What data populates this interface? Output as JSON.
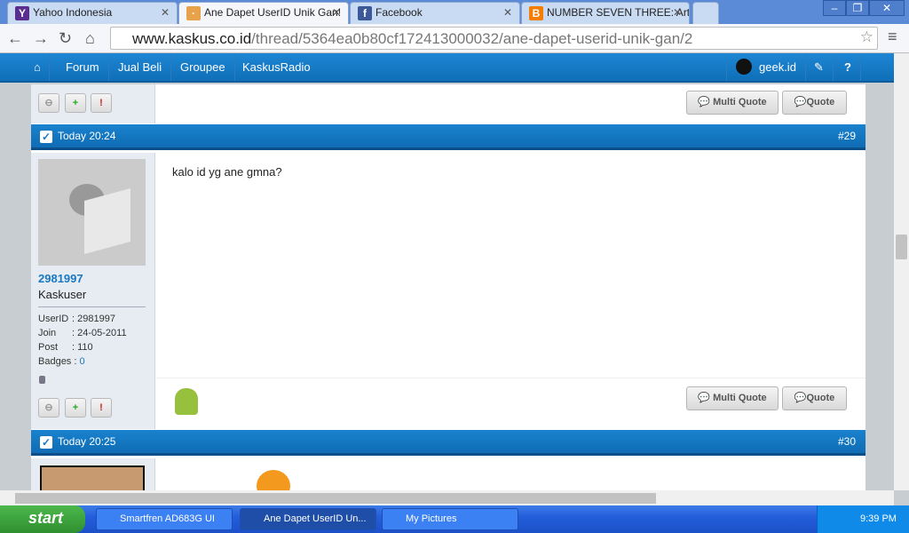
{
  "browser": {
    "tabs": [
      {
        "label": "Yahoo Indonesia",
        "icon": "yahoo-icon",
        "color": "#5c2d91"
      },
      {
        "label": "Ane Dapet UserID Unik Gan!",
        "icon": "kaskus-icon",
        "color": "#e8a24a"
      },
      {
        "label": "Facebook",
        "icon": "facebook-icon",
        "color": "#3b5998"
      },
      {
        "label": "NUMBER SEVEN THREE: Arti",
        "icon": "blogger-icon",
        "color": "#f57d00"
      }
    ],
    "url_host": "www.kaskus.co.id",
    "url_path": "/thread/5364ea0b80cf172413000032/ane-dapet-userid-unik-gan/2"
  },
  "sitenav": {
    "items": [
      "Forum",
      "Jual Beli",
      "Groupee",
      "KaskusRadio"
    ],
    "username": "geek.id"
  },
  "buttons": {
    "multi_quote": "Multi Quote",
    "quote": "Quote"
  },
  "posts": [
    {
      "time": "Today 20:24",
      "number": "#29",
      "username": "2981997",
      "rank": "Kaskuser",
      "info": [
        {
          "label": "UserID",
          "value": ": 2981997"
        },
        {
          "label": "Join",
          "value": ": 24-05-2011"
        },
        {
          "label": "Post",
          "value": ": 110"
        },
        {
          "label": "Badges",
          "value": ": ",
          "link": "0"
        }
      ],
      "body": "kalo id yg ane gmna?"
    },
    {
      "time": "Today 20:25",
      "number": "#30"
    }
  ],
  "taskbar": {
    "start": "start",
    "items": [
      "Smartfren AD683G UI",
      "Ane Dapet UserID Un...",
      "My Pictures"
    ],
    "clock": "9:39 PM"
  },
  "colors": {
    "accent": "#1a7ac5",
    "username": "#1a78c2"
  }
}
